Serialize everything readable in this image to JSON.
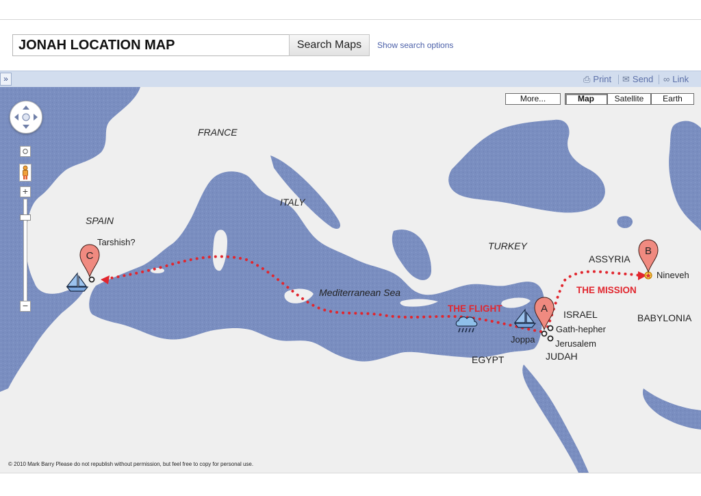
{
  "search": {
    "value": "JONAH LOCATION MAP",
    "button_label": "Search Maps",
    "options_link": "Show search options"
  },
  "toolbar": {
    "print_label": "Print",
    "send_label": "Send",
    "link_label": "Link"
  },
  "map_types": {
    "more_label": "More...",
    "map_label": "Map",
    "satellite_label": "Satellite",
    "earth_label": "Earth",
    "selected": "Map"
  },
  "labels": {
    "france": "FRANCE",
    "spain": "SPAIN",
    "italy": "ITALY",
    "turkey": "TURKEY",
    "sea": "Mediterranean Sea",
    "assyria": "ASSYRIA",
    "babylonia": "BABYLONIA",
    "israel": "ISRAEL",
    "judah": "JUDAH",
    "egypt": "EGYPT",
    "tarshish": "Tarshish?",
    "nineveh": "Nineveh",
    "gath_hepher": "Gath-hepher",
    "jerusalem": "Jerusalem",
    "joppa": "Joppa",
    "flight": "THE FLIGHT",
    "mission": "THE MISSION"
  },
  "markers": {
    "a": "A",
    "b": "B",
    "c": "C"
  },
  "zoom": {
    "plus": "+",
    "minus": "−"
  },
  "copyright": "© 2010 Mark Barry  Please do not republish without permission, but feel free to copy for personal use.",
  "colors": {
    "sea": "#7a8ec0",
    "land": "#efefef",
    "route": "#e1262e",
    "marker": "#f08a80",
    "toolbar": "#d2ddee",
    "link": "#4a5fa8"
  },
  "icons": [
    "expand-icon",
    "print-icon",
    "send-icon",
    "link-icon",
    "pan-icon",
    "pegman-icon",
    "boat-icon",
    "storm-icon",
    "star-icon"
  ]
}
